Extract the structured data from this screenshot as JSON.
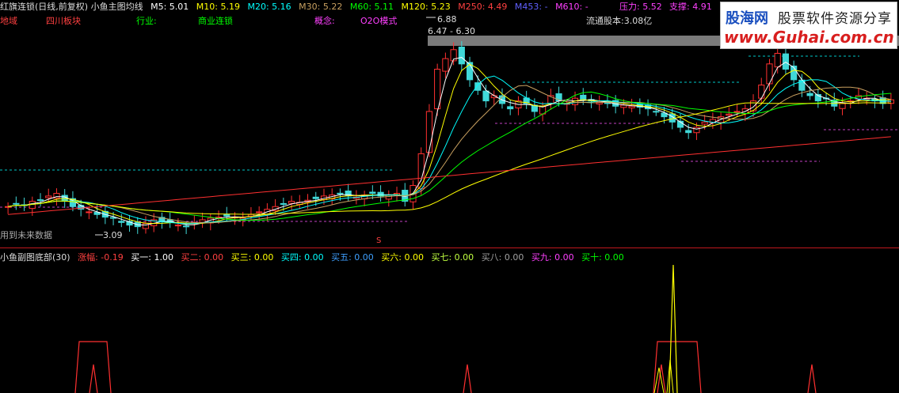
{
  "main_header": {
    "title": "红旗连锁(日线,前复权) 小鱼主图均线",
    "m5": "M5: 5.01",
    "m10": "M10: 5.19",
    "m20": "M20: 5.16",
    "m30": "M30: 5.22",
    "m60": "M60: 5.11",
    "m120": "M120: 5.23",
    "m250": "M250: 4.49",
    "m453": "M453: -",
    "m610": "M610: -",
    "pressure": "压力: 5.52",
    "support": "支撑: 4.91",
    "colors": {
      "m5": "#ffffff",
      "m10": "#ffff00",
      "m20": "#00ffff",
      "m30": "#c8a060",
      "m60": "#00ff00",
      "m120": "#ffff00",
      "m250": "#ff4040",
      "m453": "#5050ff",
      "m610": "#ff40ff"
    }
  },
  "info_row": {
    "region_label": "地域",
    "region_value": "四川板块",
    "industry_label": "行业:",
    "industry_value": "商业连锁",
    "concept_label": "概念:",
    "concept_value": "O2O模式",
    "float_shares": "流通股本:3.08亿"
  },
  "annotations": {
    "high_price": "6.88",
    "range_box": "6.47 - 6.30",
    "low_price": "3.09",
    "future_data_note": "用到未来数据",
    "s_marker": "S"
  },
  "logo": {
    "brand": "股海网",
    "tagline": "股票软件资源分享",
    "url": "www.Guhai.com.cn"
  },
  "sub_header": {
    "title": "小鱼副图底部(30)",
    "zhangfu": "涨幅: -0.19",
    "buy1": "买一: 1.00",
    "buy2": "买二: 0.00",
    "buy3": "买三: 0.00",
    "buy4": "买四: 0.00",
    "buy5": "买五: 0.00",
    "buy6": "买六: 0.00",
    "buy7": "买七: 0.00",
    "buy8": "买八: 0.00",
    "buy9": "买九: 0.00",
    "buy10": "买十: 0.00",
    "colors": {
      "zhangfu": "#ff4040",
      "buy1": "#ffffff",
      "buy2": "#ff4040",
      "buy3": "#ffff00",
      "buy4": "#00ffff",
      "buy5": "#3fa0ff",
      "buy6": "#ffff00",
      "buy7": "#c0ff40",
      "buy8": "#a0a0a0",
      "buy9": "#ff40ff",
      "buy10": "#00ff00"
    }
  },
  "chart_data": [
    {
      "type": "candlestick",
      "title": "红旗连锁(日线,前复权)",
      "closes": [
        3.5,
        3.55,
        3.52,
        3.6,
        3.62,
        3.7,
        3.75,
        3.6,
        3.5,
        3.45,
        3.4,
        3.35,
        3.3,
        3.28,
        3.2,
        3.15,
        3.12,
        3.18,
        3.25,
        3.22,
        3.2,
        3.15,
        3.12,
        3.2,
        3.25,
        3.28,
        3.3,
        3.32,
        3.3,
        3.28,
        3.35,
        3.4,
        3.45,
        3.5,
        3.55,
        3.6,
        3.58,
        3.62,
        3.65,
        3.7,
        3.72,
        3.75,
        3.7,
        3.68,
        3.72,
        3.75,
        3.7,
        3.72,
        3.75,
        3.6,
        3.9,
        4.5,
        5.3,
        6.1,
        6.3,
        6.47,
        6.2,
        5.9,
        5.7,
        5.5,
        5.6,
        5.45,
        5.35,
        5.5,
        5.45,
        5.3,
        5.4,
        5.6,
        5.5,
        5.45,
        5.55,
        5.52,
        5.5,
        5.48,
        5.45,
        5.4,
        5.42,
        5.4,
        5.38,
        5.35,
        5.3,
        5.2,
        5.1,
        5.0,
        4.9,
        5.0,
        5.1,
        5.15,
        5.2,
        5.25,
        5.3,
        5.35,
        5.5,
        5.8,
        6.2,
        6.4,
        6.1,
        5.9,
        5.7,
        5.6,
        5.5,
        5.55,
        5.4,
        5.45,
        5.5,
        5.6,
        5.55,
        5.5,
        5.45,
        5.52
      ],
      "ma_lines": [
        "M5",
        "M10",
        "M20",
        "M30",
        "M60",
        "M120",
        "M250"
      ],
      "high_label": 6.88,
      "low_label": 3.09
    },
    {
      "type": "line",
      "title": "小鱼副图底部(30)",
      "series": [
        {
          "name": "买一",
          "values_plateaus": [
            [
              95,
              140
            ],
            [
              825,
              885
            ]
          ]
        },
        {
          "name": "涨幅",
          "spikes": [
            118,
            590,
            835,
            850,
            1025
          ]
        }
      ]
    }
  ]
}
